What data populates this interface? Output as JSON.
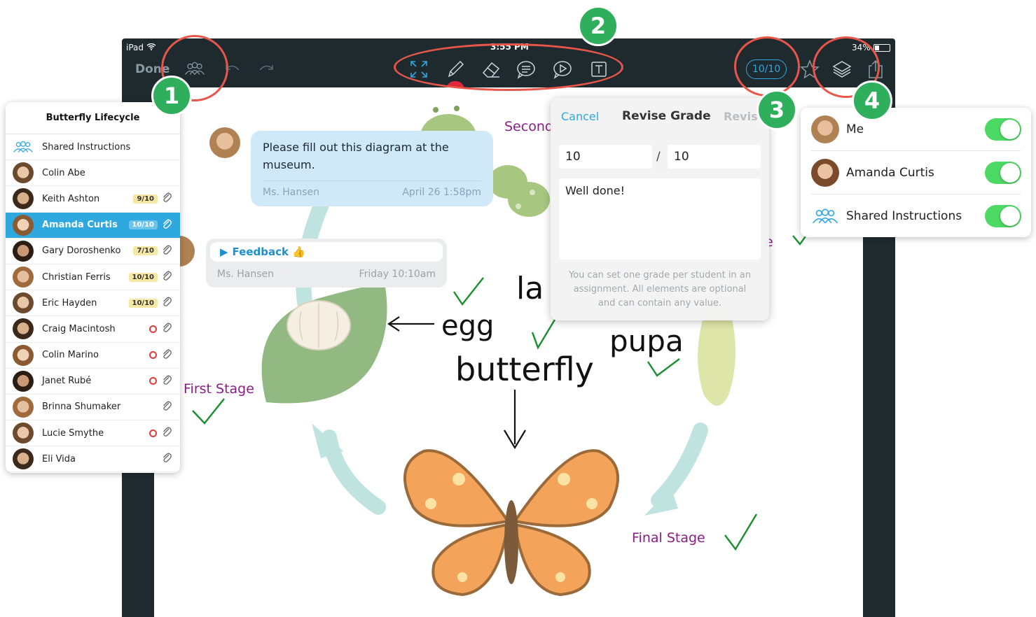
{
  "status_bar": {
    "device": "iPad",
    "time": "3:55 PM",
    "battery": "34%",
    "battery_level": 0.34
  },
  "toolbar": {
    "done_label": "Done",
    "grade": "10/10",
    "icons": [
      "students-icon",
      "undo-icon",
      "redo-icon",
      "fullscreen-icon",
      "pencil-icon",
      "eraser-icon",
      "comment-icon",
      "play-icon",
      "text-icon",
      "star-icon",
      "layers-icon",
      "share-icon"
    ]
  },
  "callouts": [
    "1",
    "2",
    "3",
    "4"
  ],
  "student_panel": {
    "title": "Butterfly Lifecycle",
    "shared_label": "Shared Instructions",
    "students": [
      {
        "name": "Colin Abe",
        "grade": "",
        "pending": false,
        "attachment": false
      },
      {
        "name": "Keith Ashton",
        "grade": "9/10",
        "pending": false,
        "attachment": true
      },
      {
        "name": "Amanda Curtis",
        "grade": "10/10",
        "pending": false,
        "attachment": true,
        "selected": true
      },
      {
        "name": "Gary Doroshenko",
        "grade": "7/10",
        "pending": false,
        "attachment": true
      },
      {
        "name": "Christian Ferris",
        "grade": "10/10",
        "pending": false,
        "attachment": true
      },
      {
        "name": "Eric Hayden",
        "grade": "10/10",
        "pending": false,
        "attachment": true
      },
      {
        "name": "Craig Macintosh",
        "grade": "",
        "pending": true,
        "attachment": true
      },
      {
        "name": "Colin Marino",
        "grade": "",
        "pending": true,
        "attachment": true
      },
      {
        "name": "Janet Rubé",
        "grade": "",
        "pending": true,
        "attachment": true
      },
      {
        "name": "Brinna Shumaker",
        "grade": "",
        "pending": false,
        "attachment": true
      },
      {
        "name": "Lucie Smythe",
        "grade": "",
        "pending": true,
        "attachment": true
      },
      {
        "name": "Eli Vida",
        "grade": "",
        "pending": false,
        "attachment": true
      }
    ]
  },
  "messages": {
    "instruction": {
      "text": "Please fill out this diagram at the museum.",
      "author": "Ms. Hansen",
      "date": "April 26 1:58pm"
    },
    "feedback": {
      "label": "Feedback 👍",
      "author": "Ms. Hansen",
      "date": "Friday 10:10am"
    }
  },
  "diagram": {
    "labels": {
      "second": "Second",
      "first": "First Stage",
      "final": "Final Stage",
      "e_fragment": "e"
    },
    "handwriting": {
      "egg": "egg",
      "larva": "la",
      "pupa": "pupa",
      "butterfly": "butterfly"
    }
  },
  "revise_grade": {
    "cancel": "Cancel",
    "title": "Revise Grade",
    "revise": "Revise",
    "score": "10",
    "separator": "/",
    "out_of": "10",
    "comment": "Well done!",
    "help": "You can set one grade per student in an assignment. All elements are optional and can contain any value."
  },
  "layers": [
    {
      "label": "Me",
      "on": true
    },
    {
      "label": "Amanda Curtis",
      "on": true
    },
    {
      "label": "Shared Instructions",
      "on": true
    }
  ],
  "colors": {
    "accent": "#2fa8e0",
    "callout": "#2fae5c",
    "ring": "#e8564a",
    "stage_label": "#8b1d86",
    "toggle": "#4cd964"
  }
}
